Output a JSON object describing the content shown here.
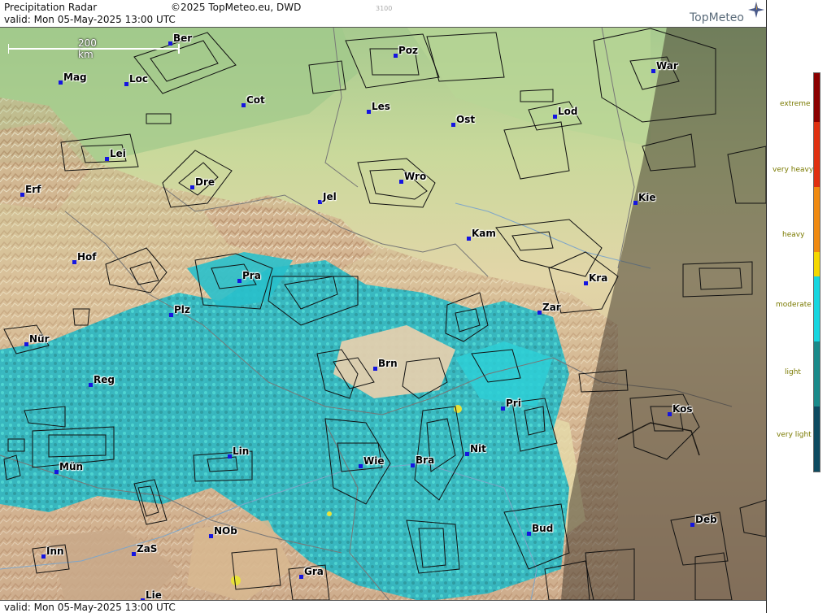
{
  "header": {
    "title": "Precipitation Radar",
    "copyright": "©2025 TopMeteo.eu, DWD",
    "valid": "valid:  Mon  05-May-2025 13:00 UTC",
    "code": "3100",
    "brand": "TopMeteo"
  },
  "footer": {
    "valid": "valid:  Mon  05-May-2025 13:00 UTC"
  },
  "scale_bar": {
    "label": "200 km"
  },
  "cities": [
    {
      "name": "Ber"
    },
    {
      "name": "Poz"
    },
    {
      "name": "War"
    },
    {
      "name": "Mag"
    },
    {
      "name": "Loc"
    },
    {
      "name": "Cot"
    },
    {
      "name": "Les"
    },
    {
      "name": "Lod"
    },
    {
      "name": "Ost"
    },
    {
      "name": "Lei"
    },
    {
      "name": "Dre"
    },
    {
      "name": "Wro"
    },
    {
      "name": "Erf"
    },
    {
      "name": "Jel"
    },
    {
      "name": "Kie"
    },
    {
      "name": "Kam"
    },
    {
      "name": "Hof"
    },
    {
      "name": "Pra"
    },
    {
      "name": "Kra"
    },
    {
      "name": "Plz"
    },
    {
      "name": "Zar"
    },
    {
      "name": "Nür"
    },
    {
      "name": "Brn"
    },
    {
      "name": "Reg"
    },
    {
      "name": "Pri"
    },
    {
      "name": "Kos"
    },
    {
      "name": "Nit"
    },
    {
      "name": "Lin"
    },
    {
      "name": "Wie"
    },
    {
      "name": "Bra"
    },
    {
      "name": "Mün"
    },
    {
      "name": "Deb"
    },
    {
      "name": "Bud"
    },
    {
      "name": "NOb"
    },
    {
      "name": "Inn"
    },
    {
      "name": "ZaS"
    },
    {
      "name": "Gra"
    },
    {
      "name": "Lie"
    }
  ],
  "legend": {
    "labels": [
      "extreme",
      "very heavy",
      "heavy",
      "moderate",
      "light",
      "very light"
    ],
    "colors": [
      "#8b0000",
      "#e03010",
      "#f08a10",
      "#f5d800",
      "#16d6e0",
      "#1a8a8a",
      "#0d4a60"
    ]
  }
}
